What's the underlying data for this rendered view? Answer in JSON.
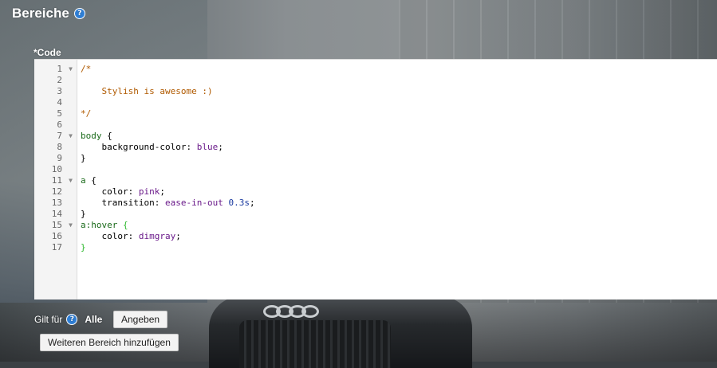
{
  "header": {
    "title": "Bereiche",
    "help_icon": "?"
  },
  "editor": {
    "label": "*Code",
    "lines": [
      {
        "n": "1",
        "fold": true
      },
      {
        "n": "2",
        "fold": false
      },
      {
        "n": "3",
        "fold": false
      },
      {
        "n": "4",
        "fold": false
      },
      {
        "n": "5",
        "fold": false
      },
      {
        "n": "6",
        "fold": false
      },
      {
        "n": "7",
        "fold": true
      },
      {
        "n": "8",
        "fold": false
      },
      {
        "n": "9",
        "fold": false
      },
      {
        "n": "10",
        "fold": false
      },
      {
        "n": "11",
        "fold": true
      },
      {
        "n": "12",
        "fold": false
      },
      {
        "n": "13",
        "fold": false
      },
      {
        "n": "14",
        "fold": false
      },
      {
        "n": "15",
        "fold": true
      },
      {
        "n": "16",
        "fold": false
      },
      {
        "n": "17",
        "fold": false
      }
    ],
    "code": {
      "l1": "/*",
      "l3": "    Stylish is awesome :)",
      "l5": "*/",
      "l7_sel": "body",
      "l7_brace": " {",
      "l8_prop": "    background-color: ",
      "l8_val": "blue",
      "l8_end": ";",
      "l9": "}",
      "l11_sel": "a",
      "l11_brace": " {",
      "l12_prop": "    color: ",
      "l12_val": "pink",
      "l12_end": ";",
      "l13_prop": "    transition: ",
      "l13_val": "ease-in-out",
      "l13_num": " 0.3s",
      "l13_end": ";",
      "l14": "}",
      "l15_sel": "a",
      "l15_pseudo": ":hover",
      "l15_brace": " {",
      "l16_prop": "    color: ",
      "l16_val": "dimgray",
      "l16_end": ";",
      "l17": "}"
    }
  },
  "applies_to": {
    "label": "Gilt für",
    "value": "Alle",
    "help_icon": "?",
    "specify_button": "Angeben"
  },
  "add_section_button": "Weiteren Bereich hinzufügen",
  "colors": {
    "comment": "#b05a00",
    "selector": "#1a6a1a",
    "keyword_value": "#6a1a8a",
    "number": "#1a3aa0",
    "help_icon": "#2f7fd6"
  }
}
